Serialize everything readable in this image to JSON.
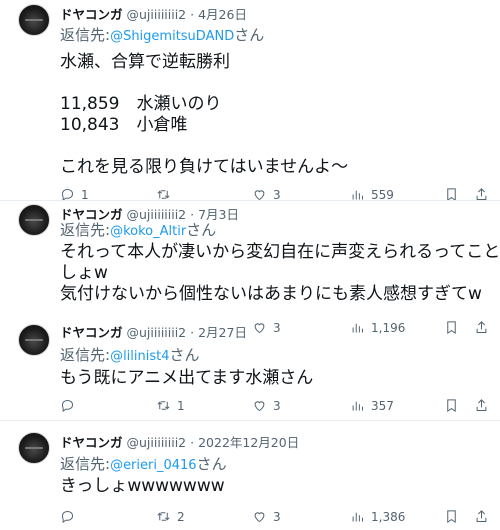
{
  "tweets": [
    {
      "name": "ドヤコンガ",
      "handle": "@ujiiiiiiii2",
      "sep": "·",
      "date": "4月26日",
      "reply_label": "返信先:",
      "mention": "@ShigemitsuDAND",
      "honorific": "さん",
      "lines": [
        "水瀬、合算で逆転勝利",
        "",
        "11,859　水瀬いのり",
        "10,843　小倉唯",
        "",
        "これを見る限り負けてはいませんよ～"
      ],
      "replies": "1",
      "retweets": "",
      "likes": "3",
      "views": "559"
    },
    {
      "name": "ドヤコンガ",
      "handle": "@ujiiiiiiii2",
      "sep": "·",
      "date": "7月3日",
      "reply_label": "返信先:",
      "mention": "@koko_Altir",
      "honorific": "さん",
      "lines": [
        "それって本人が凄いから変幻自在に声変えられるってことで",
        "しょw",
        "気付けないから個性ないはあまりにも素人感想すぎてw"
      ],
      "replies": "",
      "retweets": "",
      "likes": "",
      "views": ""
    },
    {
      "name": "ドヤコンガ",
      "handle": "@ujiiiiiiii2",
      "sep": "·",
      "date": "2月27日",
      "reply_label": "返信先:",
      "mention": "@lilinist4",
      "honorific": "さん",
      "lines": [
        "もう既にアニメ出てます水瀬さん"
      ],
      "replies": "",
      "retweets": "1",
      "likes": "3",
      "views": "357"
    },
    {
      "name": "ドヤコンガ",
      "handle": "@ujiiiiiiii2",
      "sep": "·",
      "date": "2022年12月20日",
      "reply_label": "返信先:",
      "mention": "@erieri_0416",
      "honorific": "さん",
      "lines": [
        "きっしょwwwwwww"
      ],
      "replies": "",
      "retweets": "2",
      "likes": "3",
      "views": "1,386"
    }
  ],
  "inline_metrics_tweet2": {
    "likes": "3",
    "views": "1,196"
  },
  "icons": [
    "reply-icon",
    "retweet-icon",
    "like-icon",
    "views-icon",
    "bookmark-icon",
    "share-icon"
  ],
  "colors": {
    "mention": "#1d9bf0",
    "secondary": "#536471",
    "text": "#0f1419",
    "divider": "#e6ecf0"
  }
}
